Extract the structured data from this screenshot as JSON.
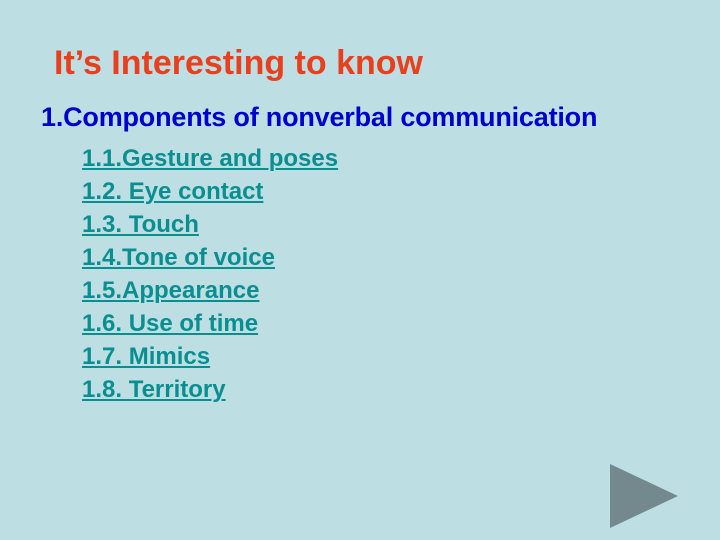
{
  "slide": {
    "title": "It’s Interesting to know",
    "title_color": "#e8401c",
    "background_color": "#bddee3",
    "heading": {
      "text": "1.Components of nonverbal communication",
      "color": "#0000cc"
    },
    "sub_items": [
      {
        "label": "1.1.Gesture and poses"
      },
      {
        "label": "1.2. Eye contact"
      },
      {
        "label": "1.3. Touch"
      },
      {
        "label": "1.4.Tone of voice"
      },
      {
        "label": "1.5.Appearance"
      },
      {
        "label": "1.6. Use of time"
      },
      {
        "label": "1.7. Mimics"
      },
      {
        "label": "1.8. Territory"
      }
    ],
    "sub_item_color": "#0a8f91",
    "advance_control": {
      "icon": "play-triangle-icon",
      "color": "#74898d"
    }
  }
}
